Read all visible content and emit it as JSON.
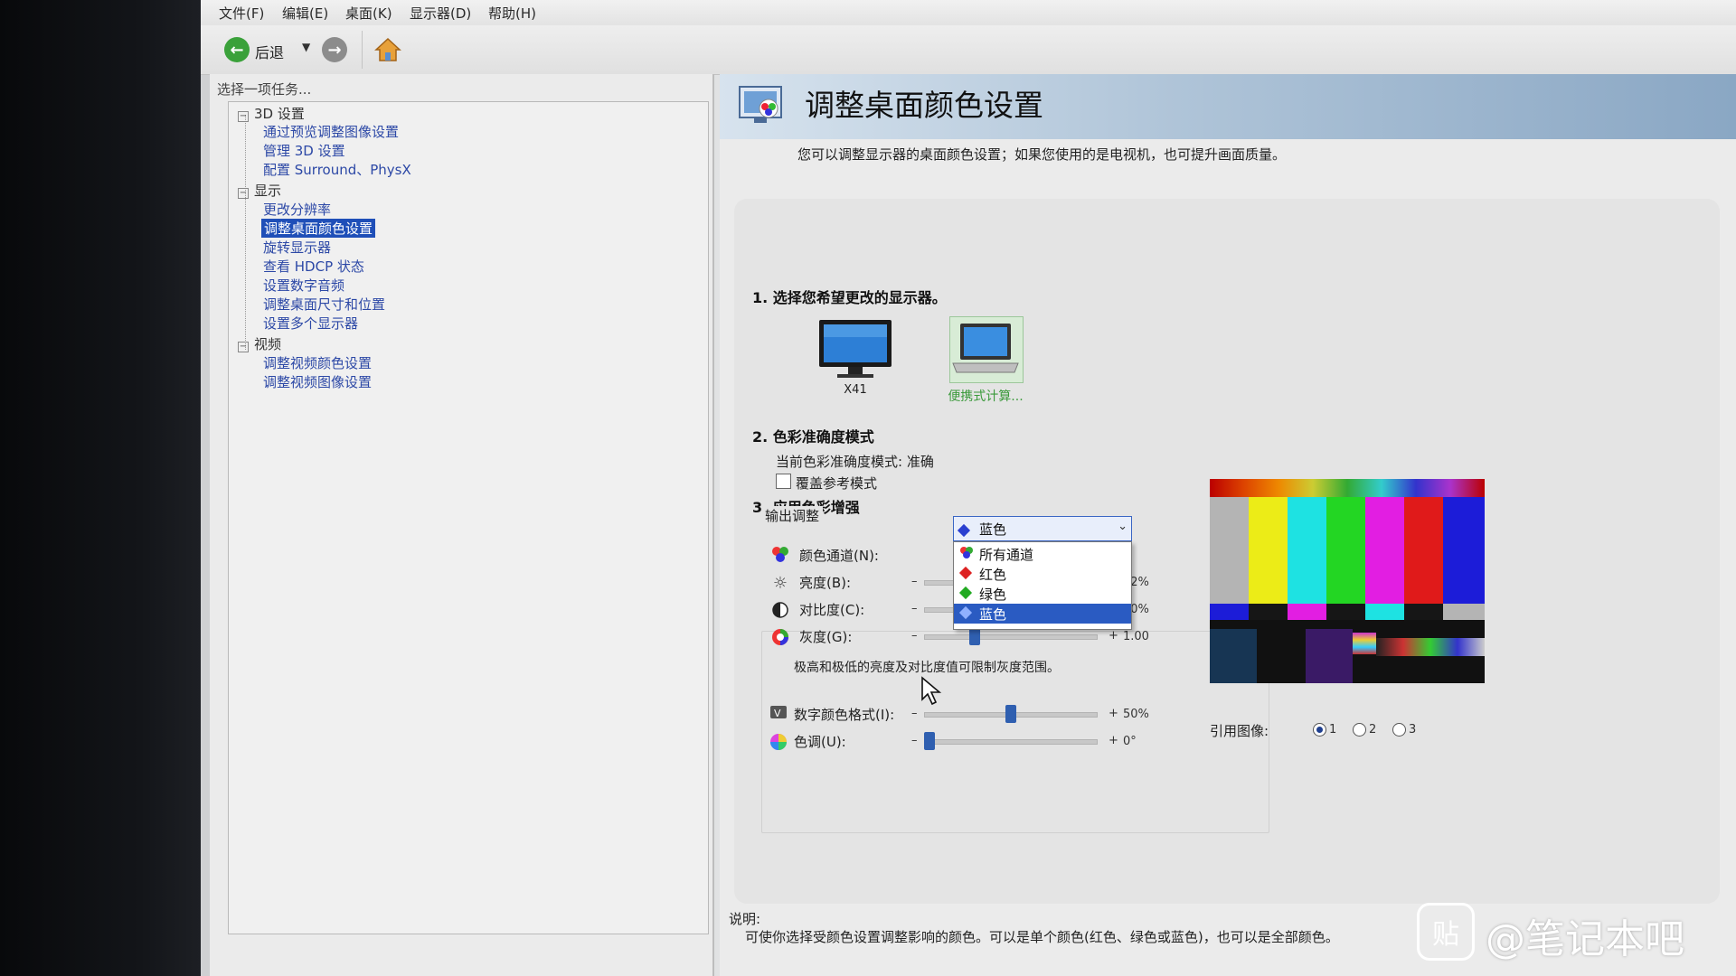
{
  "menu": [
    "文件(F)",
    "编辑(E)",
    "桌面(K)",
    "显示器(D)",
    "帮助(H)"
  ],
  "toolbar": {
    "back_label": "后退"
  },
  "sidebar": {
    "title": "选择一项任务...",
    "groups": [
      {
        "label": "3D 设置",
        "items": [
          "通过预览调整图像设置",
          "管理 3D 设置",
          "配置 Surround、PhysX"
        ]
      },
      {
        "label": "显示",
        "items": [
          "更改分辨率",
          "调整桌面颜色设置",
          "旋转显示器",
          "查看 HDCP 状态",
          "设置数字音频",
          "调整桌面尺寸和位置",
          "设置多个显示器"
        ]
      },
      {
        "label": "视频",
        "items": [
          "调整视频颜色设置",
          "调整视频图像设置"
        ]
      }
    ],
    "selected": "调整桌面颜色设置"
  },
  "page": {
    "title": "调整桌面颜色设置",
    "intro": "您可以调整显示器的桌面颜色设置；如果您使用的是电视机，也可提升画面质量。",
    "section1": "1. 选择您希望更改的显示器。",
    "displays": [
      {
        "name": "X41",
        "selected": false
      },
      {
        "name": "便携式计算...",
        "selected": true
      }
    ],
    "section2": "2. 色彩准确度模式",
    "accuracy_mode": "当前色彩准确度模式: 准确",
    "override_label": "覆盖参考模式",
    "section3": "3. 应用色彩增强",
    "output_adjust": "输出调整",
    "channel_label": "颜色通道(N):",
    "channel_value": "蓝色",
    "channel_options": [
      "所有通道",
      "红色",
      "绿色",
      "蓝色"
    ],
    "brightness_label": "亮度(B):",
    "brightness_value": "52%",
    "contrast_label": "对比度(C):",
    "contrast_value": "50%",
    "gamma_label": "灰度(G):",
    "gamma_value": "1.00",
    "range_note": "极高和极低的亮度及对比度值可限制灰度范围。",
    "digital_label": "数字颜色格式(I):",
    "digital_value": "50%",
    "hue_label": "色调(U):",
    "hue_value": "0°",
    "ref_label": "引用图像:",
    "ref_options": [
      "1",
      "2",
      "3"
    ],
    "ref_selected": "1",
    "minus": "–",
    "plus": "+",
    "desc_label": "说明:",
    "desc": "可使你选择受颜色设置调整影响的颜色。可以是单个颜色(红色、绿色或蓝色)，也可以是全部颜色。"
  },
  "watermark": {
    "badge": "贴",
    "text": "@笔记本吧"
  },
  "colors": {
    "accent": "#2a5bc2",
    "link": "#2c48a6",
    "banner": "#8aa7c4"
  }
}
